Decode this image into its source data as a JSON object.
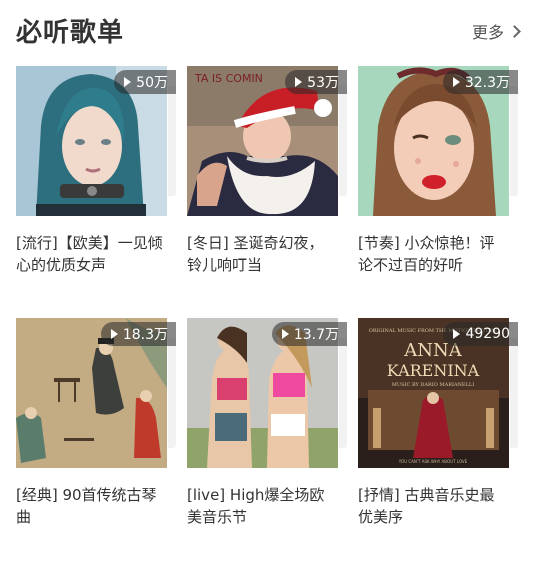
{
  "section": {
    "title": "必听歌单",
    "more_label": "更多"
  },
  "playlists": [
    {
      "count": "50万",
      "title": "[流行]【欧美】一见倾心的优质女声",
      "icon": "play-icon"
    },
    {
      "count": "53万",
      "title": "[冬日] 圣诞奇幻夜，铃儿响叮当",
      "icon": "play-icon"
    },
    {
      "count": "32.3万",
      "title": "[节奏] 小众惊艳！评论不过百的好听",
      "icon": "play-icon"
    },
    {
      "count": "18.3万",
      "title": "[经典] 90首传统古琴曲",
      "icon": "play-icon"
    },
    {
      "count": "13.7万",
      "title": "[live] High爆全场欧美音乐节",
      "icon": "play-icon"
    },
    {
      "count": "49290",
      "title": "[抒情] 古典音乐史最优美序",
      "icon": "play-icon"
    }
  ],
  "cover_text": {
    "p2_sign": "TA  IS COMIN",
    "p6_title_top": "ANNA",
    "p6_title_bottom": "KARENINA",
    "p6_small": "ORIGINAL MUSIC FROM THE MOTION PICTURE",
    "p6_composer": "MUSIC BY DARIO MARIANELLI",
    "p6_tagline": "YOU CAN'T ASK WHY ABOUT LOVE"
  },
  "colors": {
    "title": "#333333",
    "badge_bg": "rgba(40,40,40,0.55)",
    "text": "#333333"
  }
}
